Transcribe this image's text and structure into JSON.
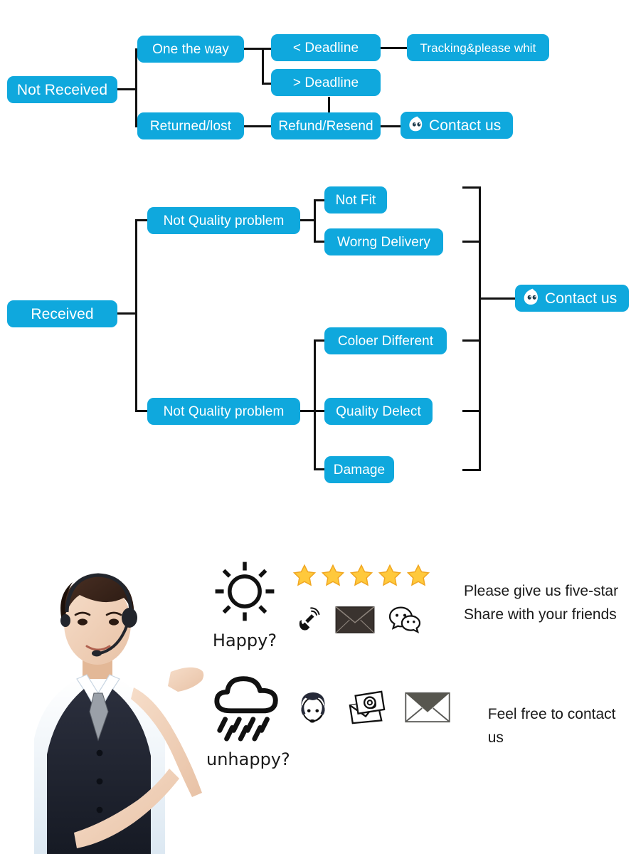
{
  "theme": {
    "node_blue": "#0FA8DD",
    "line_black": "#111111",
    "star_gold": "#FFC93C",
    "text_dark": "#1a1a1a"
  },
  "flowchart_not_received": {
    "root": "Not Received",
    "nodes": {
      "one_the_way": "One the way",
      "before_deadline": "< Deadline",
      "after_deadline": "> Deadline",
      "tracking": "Tracking&please whit",
      "returned_lost": "Returned/lost",
      "refund_resend": "Refund/Resend",
      "contact_us": "Contact us"
    }
  },
  "flowchart_received": {
    "root": "Received",
    "nodes": {
      "not_quality_problem_top": "Not Quality problem",
      "not_fit": "Not Fit",
      "worng_delivery": "Worng Delivery",
      "not_quality_problem_bottom": "Not Quality problem",
      "coloer_different": "Coloer Different",
      "quality_delect": "Quality Delect",
      "damage": "Damage",
      "contact_us": "Contact us"
    }
  },
  "banner": {
    "happy": {
      "caption": "Happy?",
      "stars": 5,
      "messages": [
        "Please give us five-star",
        "Share with your friends"
      ],
      "icons": [
        "sun-icon",
        "star-icon",
        "phone-ringing-icon",
        "envelope-icon",
        "wechat-icon"
      ]
    },
    "unhappy": {
      "caption": "unhappy?",
      "message": "Feel free to contact us",
      "icons": [
        "rain-cloud-icon",
        "operator-headset-icon",
        "email-at-icon",
        "envelope-icon"
      ]
    }
  }
}
